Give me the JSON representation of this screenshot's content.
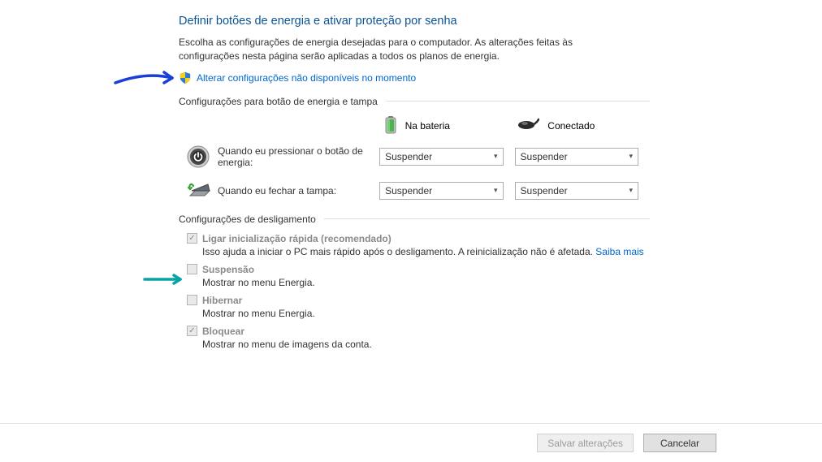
{
  "title": "Definir botões de energia e ativar proteção por senha",
  "description": "Escolha as configurações de energia desejadas para o computador. As alterações feitas às configurações nesta página serão aplicadas a todos os planos de energia.",
  "change_link": "Alterar configurações não disponíveis no momento",
  "section_buttons": "Configurações para botão de energia e tampa",
  "col_battery": "Na bateria",
  "col_plugged": "Conectado",
  "rows": {
    "power": {
      "label": "Quando eu pressionar o botão de energia:",
      "battery": "Suspender",
      "plugged": "Suspender"
    },
    "lid": {
      "label": "Quando eu fechar a tampa:",
      "battery": "Suspender",
      "plugged": "Suspender"
    }
  },
  "section_shutdown": "Configurações de desligamento",
  "shutdown": {
    "faststart": {
      "title": "Ligar inicialização rápida (recomendado)",
      "sub": "Isso ajuda a iniciar o PC mais rápido após o desligamento. A reinicialização não é afetada. ",
      "link": "Saiba mais"
    },
    "sleep": {
      "title": "Suspensão",
      "sub": "Mostrar no menu Energia."
    },
    "hibernate": {
      "title": "Hibernar",
      "sub": "Mostrar no menu Energia."
    },
    "lock": {
      "title": "Bloquear",
      "sub": "Mostrar no menu de imagens da conta."
    }
  },
  "buttons": {
    "save": "Salvar alterações",
    "cancel": "Cancelar"
  }
}
